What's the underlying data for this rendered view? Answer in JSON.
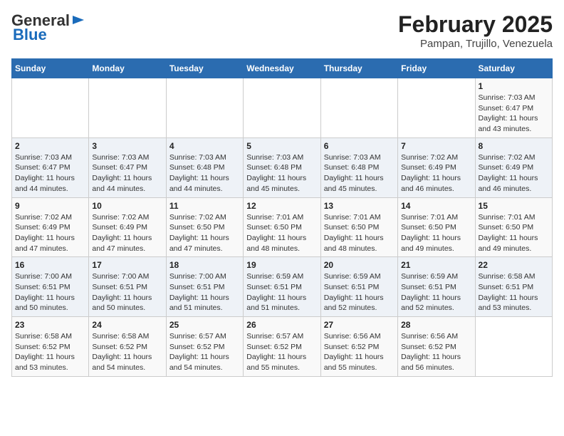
{
  "header": {
    "logo_general": "General",
    "logo_blue": "Blue",
    "title": "February 2025",
    "subtitle": "Pampan, Trujillo, Venezuela"
  },
  "calendar": {
    "days_of_week": [
      "Sunday",
      "Monday",
      "Tuesday",
      "Wednesday",
      "Thursday",
      "Friday",
      "Saturday"
    ],
    "weeks": [
      [
        {
          "day": "",
          "info": ""
        },
        {
          "day": "",
          "info": ""
        },
        {
          "day": "",
          "info": ""
        },
        {
          "day": "",
          "info": ""
        },
        {
          "day": "",
          "info": ""
        },
        {
          "day": "",
          "info": ""
        },
        {
          "day": "1",
          "info": "Sunrise: 7:03 AM\nSunset: 6:47 PM\nDaylight: 11 hours and 43 minutes."
        }
      ],
      [
        {
          "day": "2",
          "info": "Sunrise: 7:03 AM\nSunset: 6:47 PM\nDaylight: 11 hours and 44 minutes."
        },
        {
          "day": "3",
          "info": "Sunrise: 7:03 AM\nSunset: 6:47 PM\nDaylight: 11 hours and 44 minutes."
        },
        {
          "day": "4",
          "info": "Sunrise: 7:03 AM\nSunset: 6:48 PM\nDaylight: 11 hours and 44 minutes."
        },
        {
          "day": "5",
          "info": "Sunrise: 7:03 AM\nSunset: 6:48 PM\nDaylight: 11 hours and 45 minutes."
        },
        {
          "day": "6",
          "info": "Sunrise: 7:03 AM\nSunset: 6:48 PM\nDaylight: 11 hours and 45 minutes."
        },
        {
          "day": "7",
          "info": "Sunrise: 7:02 AM\nSunset: 6:49 PM\nDaylight: 11 hours and 46 minutes."
        },
        {
          "day": "8",
          "info": "Sunrise: 7:02 AM\nSunset: 6:49 PM\nDaylight: 11 hours and 46 minutes."
        }
      ],
      [
        {
          "day": "9",
          "info": "Sunrise: 7:02 AM\nSunset: 6:49 PM\nDaylight: 11 hours and 47 minutes."
        },
        {
          "day": "10",
          "info": "Sunrise: 7:02 AM\nSunset: 6:49 PM\nDaylight: 11 hours and 47 minutes."
        },
        {
          "day": "11",
          "info": "Sunrise: 7:02 AM\nSunset: 6:50 PM\nDaylight: 11 hours and 47 minutes."
        },
        {
          "day": "12",
          "info": "Sunrise: 7:01 AM\nSunset: 6:50 PM\nDaylight: 11 hours and 48 minutes."
        },
        {
          "day": "13",
          "info": "Sunrise: 7:01 AM\nSunset: 6:50 PM\nDaylight: 11 hours and 48 minutes."
        },
        {
          "day": "14",
          "info": "Sunrise: 7:01 AM\nSunset: 6:50 PM\nDaylight: 11 hours and 49 minutes."
        },
        {
          "day": "15",
          "info": "Sunrise: 7:01 AM\nSunset: 6:50 PM\nDaylight: 11 hours and 49 minutes."
        }
      ],
      [
        {
          "day": "16",
          "info": "Sunrise: 7:00 AM\nSunset: 6:51 PM\nDaylight: 11 hours and 50 minutes."
        },
        {
          "day": "17",
          "info": "Sunrise: 7:00 AM\nSunset: 6:51 PM\nDaylight: 11 hours and 50 minutes."
        },
        {
          "day": "18",
          "info": "Sunrise: 7:00 AM\nSunset: 6:51 PM\nDaylight: 11 hours and 51 minutes."
        },
        {
          "day": "19",
          "info": "Sunrise: 6:59 AM\nSunset: 6:51 PM\nDaylight: 11 hours and 51 minutes."
        },
        {
          "day": "20",
          "info": "Sunrise: 6:59 AM\nSunset: 6:51 PM\nDaylight: 11 hours and 52 minutes."
        },
        {
          "day": "21",
          "info": "Sunrise: 6:59 AM\nSunset: 6:51 PM\nDaylight: 11 hours and 52 minutes."
        },
        {
          "day": "22",
          "info": "Sunrise: 6:58 AM\nSunset: 6:51 PM\nDaylight: 11 hours and 53 minutes."
        }
      ],
      [
        {
          "day": "23",
          "info": "Sunrise: 6:58 AM\nSunset: 6:52 PM\nDaylight: 11 hours and 53 minutes."
        },
        {
          "day": "24",
          "info": "Sunrise: 6:58 AM\nSunset: 6:52 PM\nDaylight: 11 hours and 54 minutes."
        },
        {
          "day": "25",
          "info": "Sunrise: 6:57 AM\nSunset: 6:52 PM\nDaylight: 11 hours and 54 minutes."
        },
        {
          "day": "26",
          "info": "Sunrise: 6:57 AM\nSunset: 6:52 PM\nDaylight: 11 hours and 55 minutes."
        },
        {
          "day": "27",
          "info": "Sunrise: 6:56 AM\nSunset: 6:52 PM\nDaylight: 11 hours and 55 minutes."
        },
        {
          "day": "28",
          "info": "Sunrise: 6:56 AM\nSunset: 6:52 PM\nDaylight: 11 hours and 56 minutes."
        },
        {
          "day": "",
          "info": ""
        }
      ]
    ]
  }
}
